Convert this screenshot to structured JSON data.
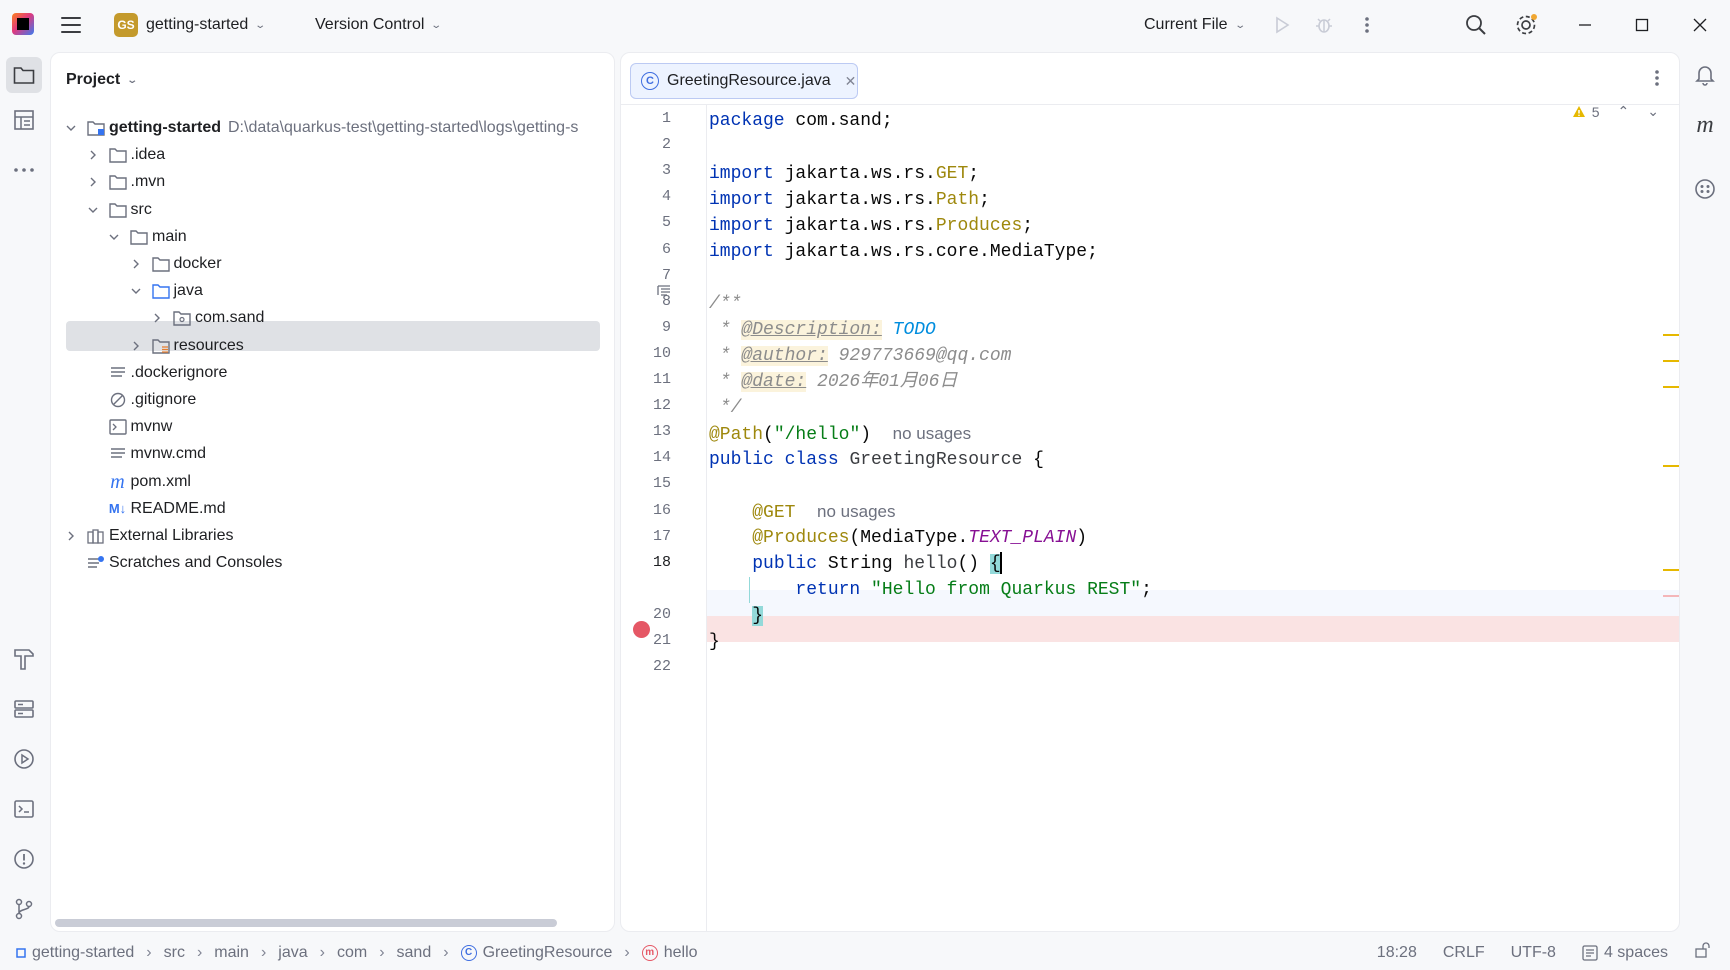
{
  "titlebar": {
    "project_badge": "GS",
    "project_name": "getting-started",
    "vcs_label": "Version Control",
    "run_config": "Current File"
  },
  "project_panel": {
    "title": "Project",
    "tree": [
      {
        "label": "getting-started",
        "hint": "D:\\data\\quarkus-test\\getting-started\\logs\\getting-s",
        "icon": "module-folder-icon",
        "expanded": true
      },
      {
        "label": ".idea",
        "icon": "folder-icon"
      },
      {
        "label": ".mvn",
        "icon": "folder-icon"
      },
      {
        "label": "src",
        "icon": "folder-icon",
        "expanded": true
      },
      {
        "label": "main",
        "icon": "folder-icon",
        "expanded": true
      },
      {
        "label": "docker",
        "icon": "folder-icon"
      },
      {
        "label": "java",
        "icon": "source-folder-icon",
        "expanded": true
      },
      {
        "label": "com.sand",
        "icon": "package-icon",
        "selected": true
      },
      {
        "label": "resources",
        "icon": "resources-folder-icon"
      },
      {
        "label": ".dockerignore",
        "icon": "text-file-icon"
      },
      {
        "label": ".gitignore",
        "icon": "ignore-file-icon"
      },
      {
        "label": "mvnw",
        "icon": "shell-script-icon"
      },
      {
        "label": "mvnw.cmd",
        "icon": "text-file-icon"
      },
      {
        "label": "pom.xml",
        "icon": "maven-icon"
      },
      {
        "label": "README.md",
        "icon": "markdown-icon"
      },
      {
        "label": "External Libraries",
        "icon": "library-icon"
      },
      {
        "label": "Scratches and Consoles",
        "icon": "scratches-icon"
      }
    ]
  },
  "editor": {
    "tab_label": "GreetingResource.java",
    "tab_icon_letter": "C",
    "warnings_count": "5",
    "current_line": 18,
    "breakpoint_line": 19,
    "line_numbers": [
      "1",
      "2",
      "3",
      "4",
      "5",
      "6",
      "7",
      "8",
      "9",
      "10",
      "11",
      "12",
      "13",
      "14",
      "15",
      "16",
      "17",
      "18",
      "",
      "20",
      "21",
      "22"
    ],
    "code": {
      "l1_kw": "package",
      "l1_rest": " com.sand;",
      "import_kw": "import",
      "l3_pkg": " jakarta.ws.rs.",
      "l3_cls": "GET",
      "l3_end": ";",
      "l4_pkg": " jakarta.ws.rs.",
      "l4_cls": "Path",
      "l4_end": ";",
      "l5_pkg": " jakarta.ws.rs.",
      "l5_cls": "Produces",
      "l5_end": ";",
      "l6_rest": " jakarta.ws.rs.core.MediaType;",
      "l8": "/**",
      "l9_pre": " * ",
      "l9_tag": "@Description:",
      "l9_todo": "TODO",
      "l10_pre": " * ",
      "l10_tag": "@author:",
      "l10_val": " 929773669@qq.com",
      "l11_pre": " * ",
      "l11_tag": "@date:",
      "l11_val": " 2026年01月06日",
      "l12": " */",
      "l13_ann": "@Path",
      "l13_paren_open": "(",
      "l13_str": "\"/hello\"",
      "l13_paren_close": ")",
      "l13_hint": "no usages",
      "l14_kw": "public class",
      "l14_cls": "GreetingResource",
      "l14_brace": " {",
      "l16_ann": "@GET",
      "l16_hint": "no usages",
      "l17_ann": "@Produces",
      "l17_open": "(MediaType.",
      "l17_field": "TEXT_PLAIN",
      "l17_close": ")",
      "l18_kw": "public",
      "l18_type": " String ",
      "l18_fn": "hello",
      "l18_parens": "() ",
      "l18_brace": "{",
      "l19_kw": "return",
      "l19_str": "\"Hello from Quarkus REST\"",
      "l19_end": ";",
      "l20": "}",
      "l21": "}"
    }
  },
  "statusbar": {
    "breadcrumbs": [
      "getting-started",
      "src",
      "main",
      "java",
      "com",
      "sand",
      "GreetingResource",
      "hello"
    ],
    "position": "18:28",
    "line_sep": "CRLF",
    "encoding": "UTF-8",
    "indent": "4 spaces"
  },
  "colors": {
    "accent": "#3574f0",
    "breakpoint": "#e55765",
    "keyword": "#0033b3",
    "annotation": "#9e880d",
    "string": "#067d17",
    "warning": "#e6b800"
  }
}
